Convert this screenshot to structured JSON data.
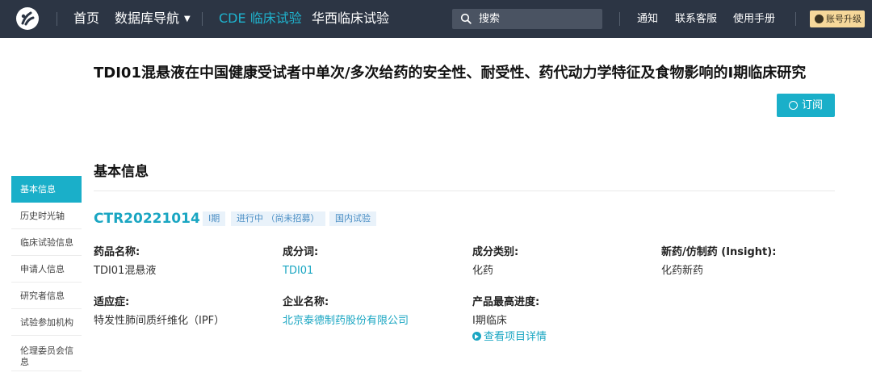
{
  "topbar": {
    "nav": [
      "首页",
      "数据库导航",
      "CDE 临床试验",
      "华西临床试验"
    ],
    "search_placeholder": "搜索",
    "links": [
      "通知",
      "联系客服",
      "使用手册"
    ],
    "upgrade_label": "账号升级"
  },
  "header": {
    "title": "TDI01混悬液在中国健康受试者中单次/多次给药的安全性、耐受性、药代动力学特征及食物影响的I期临床研究",
    "subscribe_label": "订阅"
  },
  "sidebar": {
    "items": [
      "基本信息",
      "历史时光轴",
      "临床试验信息",
      "申请人信息",
      "研究者信息",
      "试验参加机构",
      "伦理委员会信息"
    ]
  },
  "main": {
    "section_title": "基本信息",
    "trial_id": "CTR20221014",
    "tags": [
      "I期",
      "进行中 （尚未招募）",
      "国内试验"
    ],
    "fields": [
      {
        "label": "药品名称:",
        "value": "TDI01混悬液"
      },
      {
        "label": "成分词:",
        "value": "TDI01"
      },
      {
        "label": "成分类别:",
        "value": "化药"
      },
      {
        "label": "新药/仿制药 (Insight):",
        "value": "化药新药"
      },
      {
        "label": "适应症:",
        "value": "特发性肺间质纤维化（IPF）"
      },
      {
        "label": "企业名称:",
        "value": "北京泰德制药股份有限公司"
      },
      {
        "label": "产品最高进度:",
        "value": "I期临床"
      }
    ],
    "detail_link": "查看项目详情"
  },
  "colors": {
    "topbar": "#2c3544",
    "accent": "#1aafc9",
    "active_nav": "#1fb4cf",
    "upgrade_bg": "#f6d89a"
  }
}
